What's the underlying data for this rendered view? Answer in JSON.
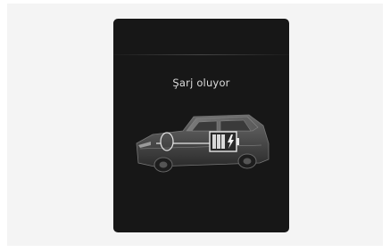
{
  "screen": {
    "status_text": "Şarj oluyor"
  },
  "icons": {
    "vehicle": "car-charging-illustration",
    "battery": "battery-charging-icon",
    "charge_port": "charge-port-icon",
    "bolt": "lightning-bolt-icon"
  },
  "colors": {
    "frame_background": "#f4f4f4",
    "screen_background": "#171717",
    "text": "#dcdcdc",
    "battery_outline": "#e8e8e8"
  }
}
